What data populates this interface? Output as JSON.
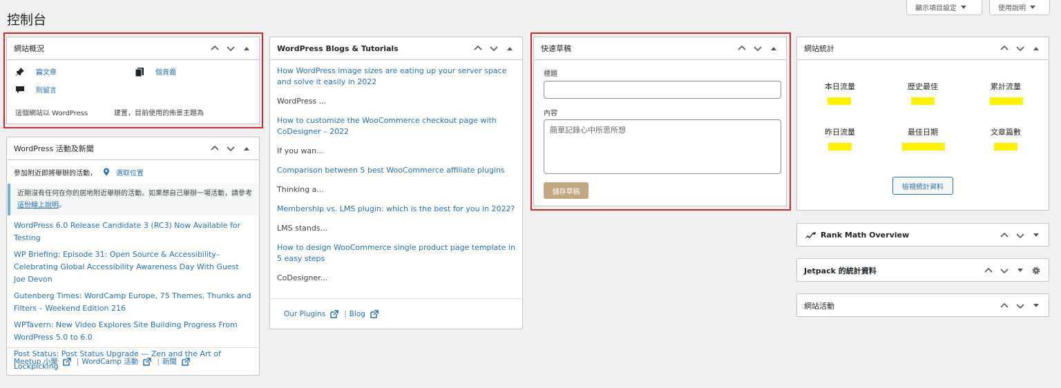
{
  "header": {
    "title": "控制台",
    "screen_options": "顯示項目設定",
    "help": "使用說明"
  },
  "glance": {
    "title": "網站概況",
    "posts": "篇文章",
    "pages": "個頁面",
    "comments": "則留言",
    "footer_left": "這個網站以 WordPress",
    "footer_right": "建置，目前使用的佈景主題為"
  },
  "events": {
    "title": "WordPress 活動及新聞",
    "location_text": "參加附近即將舉辦的活動，",
    "location_link": "選取位置",
    "notice_text": "近期沒有任何在你的居地附近舉辦的活動。如果想自己舉辦一場活動，請參考",
    "notice_link": "這份線上說明",
    "notice_end": "。",
    "news": [
      "WordPress 6.0 Release Candidate 3 (RC3) Now Available for Testing",
      "WP Briefing: Episode 31: Open Source & Accessibility– Celebrating Global Accessibility Awareness Day With Guest Joe Devon",
      "Gutenberg Times: WordCamp Europe, 75 Themes, Thunks and Filters – Weekend Edition 216",
      "WPTavern: New Video Explores Site Building Progress From WordPress 5.0 to 6.0",
      "Post Status: Post Status Upgrade — Zen and the Art of Lockpicking"
    ],
    "footer": [
      "Meetup 小聚",
      "WordCamp 活動",
      "新聞"
    ]
  },
  "blogs": {
    "title": "WordPress Blogs & Tutorials",
    "items": [
      {
        "link": "How WordPress image sizes are eating up your server space and solve it easily in 2022",
        "excerpt": "WordPress ..."
      },
      {
        "link": "How to customize the WooCommerce checkout page with CoDesigner – 2022",
        "excerpt": "If you wan..."
      },
      {
        "link": "Comparison between 5 best WooCommerce affiliate plugins",
        "excerpt": "Thinking a..."
      },
      {
        "link": "Membership vs. LMS plugin: which is the best for you in 2022?",
        "excerpt": "LMS stands..."
      },
      {
        "link": "How to design WooCommerce single product page template in 5 easy steps",
        "excerpt": "CoDesigner..."
      }
    ],
    "footer": [
      "Our Plugins",
      "Blog"
    ]
  },
  "draft": {
    "title": "快速草稿",
    "title_label": "標題",
    "content_label": "內容",
    "content_placeholder": "簡單記錄心中所思所想",
    "save": "儲存草稿"
  },
  "stats": {
    "title": "網站統計",
    "labels": [
      "本日流量",
      "歷史最佳",
      "累計流量",
      "昨日流量",
      "最佳日期",
      "文章篇數"
    ],
    "button": "檢視統計資料"
  },
  "rankmath": {
    "title": "Rank Math Overview"
  },
  "jetpack": {
    "title": "Jetpack 的統計資料"
  },
  "activity": {
    "title": "網站活動"
  },
  "colors": {
    "link": "#2271b1",
    "highlight": "#fff200",
    "frame": "#d9262c",
    "button_disabled": "#c2a781"
  }
}
